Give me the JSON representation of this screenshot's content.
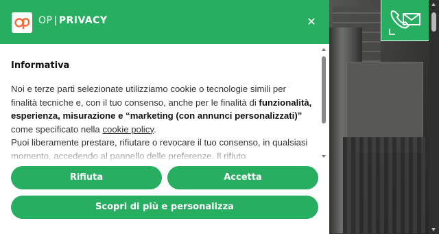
{
  "brand": {
    "op": "OP",
    "separator": "|",
    "privacy": "PRIVACY",
    "accent": "#27ae60"
  },
  "dialog": {
    "title": "Informativa",
    "text": {
      "p1_start": "Noi e terze parti selezionate utilizziamo cookie o tecnologie simili per finalità tecniche e, con il tuo consenso, anche per le finalità di ",
      "p1_bold": "funzionalità, esperienza, misurazione e “marketing (con annunci personalizzati)”",
      "p1_mid": " come specificato nella ",
      "p1_link": "cookie policy",
      "p1_end": ".",
      "p2": "Puoi liberamente prestare, rifiutare o revocare il tuo consenso, in qualsiasi momento, accedendo al pannello delle preferenze. Il rifiuto"
    },
    "buttons": {
      "reject": "Rifiuta",
      "accept": "Accetta",
      "customize": "Scopri di più e personalizza"
    },
    "close_icon": "close-icon"
  },
  "contact_icon": "phone-mail-icon"
}
